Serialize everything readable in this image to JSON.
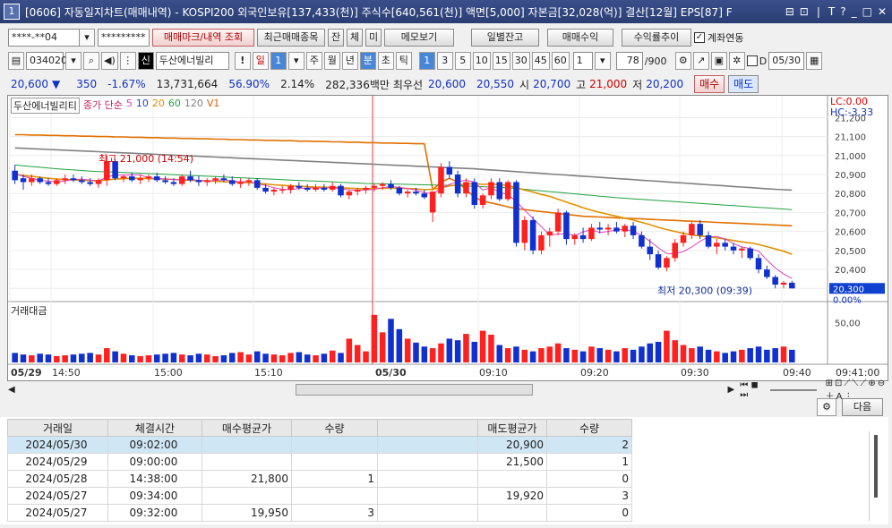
{
  "window": {
    "num": "1",
    "title": "[0606] 자동일지차트(매매내역) - KOSPI200 외국인보유[137,433(천)] 주식수[640,561(천)] 액면[5,000] 자본금[32,028(억)] 결산[12월] EPS[87] F",
    "controls": [
      "⊟",
      "⊡",
      "❘",
      "T",
      "?",
      "_",
      "□",
      "✕"
    ]
  },
  "toolbar1": {
    "account": "****-**04",
    "password": "*********",
    "btn_marks": "매매마크/내역 조회",
    "btn_recent": "최근매매종목",
    "btn_jan": "잔",
    "btn_che": "체",
    "btn_mi": "미",
    "btn_memo": "메모보기",
    "btn_daily": "일별잔고",
    "btn_profit": "매매수익",
    "btn_rate": "수익률추이",
    "chk_link": "계좌연동"
  },
  "toolbar2": {
    "code": "034020",
    "name_badge": "신",
    "name": "두산에너빌리",
    "period": [
      "일",
      "1",
      "주",
      "월",
      "년",
      "분",
      "초",
      "틱"
    ],
    "nums": [
      "1",
      "3",
      "5",
      "10",
      "15",
      "30",
      "45",
      "60"
    ],
    "count": "1",
    "view": "78",
    "total": "/900",
    "date_label": "D",
    "date": "05/30"
  },
  "quote": {
    "price": "20,600",
    "arrow": "▼",
    "change": "350",
    "pct": "-1.67%",
    "volume": "13,731,664",
    "vol_ratio": "56.90%",
    "turnover": "2.14%",
    "amount": "282,336백만",
    "best_label": "최우선",
    "ask": "20,600",
    "bid": "20,550",
    "open_label": "시",
    "open": "20,700",
    "high_label": "고",
    "high": "21,000",
    "low_label": "저",
    "low": "20,200",
    "buy": "매수",
    "sell": "매도"
  },
  "chart_data": {
    "type": "candlestick",
    "stock": "두산에너빌리티",
    "legend_price": "종가 단순",
    "ma_periods": [
      "5",
      "10",
      "20",
      "60",
      "120"
    ],
    "v1": "V1",
    "lc": "LC:0.00",
    "hc": "HC:-3.33",
    "max_label": "최고 21,000 (14:54)",
    "min_label": "최저 20,300 (09:39)",
    "last_label": "20,300",
    "last_pct": "0.00%",
    "yticks": [
      "21,200",
      "21,100",
      "21,000",
      "20,900",
      "20,800",
      "20,700",
      "20,600",
      "20,500",
      "20,400",
      "20,300"
    ],
    "ylim": [
      20240,
      21230
    ],
    "vol_title": "거래대금",
    "vol_tick": "50,00",
    "xticks": [
      {
        "label": "05/29",
        "bold": true
      },
      {
        "label": "14:50"
      },
      {
        "label": "15:00"
      },
      {
        "label": "15:10"
      },
      {
        "label": "05/30",
        "bold": true
      },
      {
        "label": "09:10"
      },
      {
        "label": "09:20"
      },
      {
        "label": "09:30"
      },
      {
        "label": "09:40"
      },
      {
        "label": "09:41:00"
      }
    ],
    "candles": [
      [
        20920,
        20950,
        20850,
        20870
      ],
      [
        20880,
        20900,
        20820,
        20860
      ],
      [
        20860,
        20900,
        20840,
        20880
      ],
      [
        20880,
        20890,
        20850,
        20860
      ],
      [
        20860,
        20880,
        20840,
        20850
      ],
      [
        20850,
        20880,
        20840,
        20870
      ],
      [
        20870,
        20900,
        20850,
        20880
      ],
      [
        20880,
        20900,
        20860,
        20870
      ],
      [
        20870,
        20890,
        20850,
        20860
      ],
      [
        20860,
        20880,
        20840,
        20850
      ],
      [
        20850,
        20880,
        20830,
        20870
      ],
      [
        20870,
        21000,
        20840,
        20970
      ],
      [
        20970,
        20980,
        20870,
        20880
      ],
      [
        20880,
        20900,
        20860,
        20890
      ],
      [
        20890,
        20910,
        20860,
        20870
      ],
      [
        20870,
        20900,
        20850,
        20880
      ],
      [
        20880,
        20900,
        20860,
        20890
      ],
      [
        20890,
        20910,
        20860,
        20870
      ],
      [
        20870,
        20890,
        20850,
        20860
      ],
      [
        20860,
        20880,
        20840,
        20850
      ],
      [
        20850,
        20900,
        20840,
        20890
      ],
      [
        20890,
        20920,
        20860,
        20870
      ],
      [
        20870,
        20890,
        20840,
        20860
      ],
      [
        20860,
        20880,
        20840,
        20870
      ],
      [
        20870,
        20890,
        20850,
        20880
      ],
      [
        20880,
        20900,
        20860,
        20870
      ],
      [
        20870,
        20890,
        20840,
        20850
      ],
      [
        20850,
        20880,
        20830,
        20860
      ],
      [
        20860,
        20880,
        20840,
        20870
      ],
      [
        20870,
        20880,
        20820,
        20830
      ],
      [
        20830,
        20850,
        20800,
        20810
      ],
      [
        20810,
        20830,
        20790,
        20820
      ],
      [
        20820,
        20840,
        20800,
        20820
      ],
      [
        20820,
        20850,
        20800,
        20840
      ],
      [
        20840,
        20860,
        20820,
        20830
      ],
      [
        20830,
        20850,
        20810,
        20820
      ],
      [
        20820,
        20850,
        20810,
        20830
      ],
      [
        20830,
        20850,
        20810,
        20820
      ],
      [
        20820,
        20860,
        20810,
        20840
      ],
      [
        20840,
        20850,
        20780,
        20790
      ],
      [
        20790,
        20820,
        20770,
        20810
      ],
      [
        20810,
        20830,
        20790,
        20820
      ],
      [
        20820,
        20840,
        20800,
        20830
      ],
      [
        20830,
        20850,
        20810,
        20840
      ],
      [
        20840,
        20860,
        20820,
        20850
      ],
      [
        20850,
        20870,
        20820,
        20830
      ],
      [
        20830,
        20840,
        20790,
        20800
      ],
      [
        20800,
        20820,
        20780,
        20810
      ],
      [
        20810,
        20830,
        20790,
        20800
      ],
      [
        20800,
        20820,
        20770,
        20780
      ],
      [
        20700,
        20810,
        20650,
        20810
      ],
      [
        20800,
        20960,
        20780,
        20940
      ],
      [
        20940,
        20970,
        20880,
        20900
      ],
      [
        20900,
        20920,
        20780,
        20800
      ],
      [
        20800,
        20880,
        20780,
        20860
      ],
      [
        20860,
        20880,
        20720,
        20740
      ],
      [
        20740,
        20800,
        20720,
        20790
      ],
      [
        20790,
        20880,
        20770,
        20860
      ],
      [
        20860,
        20880,
        20760,
        20770
      ],
      [
        20770,
        20870,
        20760,
        20860
      ],
      [
        20860,
        20870,
        20520,
        20540
      ],
      [
        20540,
        20680,
        20500,
        20660
      ],
      [
        20660,
        20680,
        20480,
        20500
      ],
      [
        20500,
        20600,
        20480,
        20580
      ],
      [
        20580,
        20620,
        20520,
        20600
      ],
      [
        20600,
        20720,
        20580,
        20700
      ],
      [
        20700,
        20710,
        20530,
        20560
      ],
      [
        20560,
        20590,
        20530,
        20580
      ],
      [
        20580,
        20620,
        20540,
        20560
      ],
      [
        20560,
        20640,
        20550,
        20620
      ],
      [
        20620,
        20650,
        20590,
        20610
      ],
      [
        20610,
        20640,
        20580,
        20620
      ],
      [
        20620,
        20650,
        20590,
        20600
      ],
      [
        20600,
        20640,
        20570,
        20630
      ],
      [
        20630,
        20650,
        20560,
        20580
      ],
      [
        20580,
        20600,
        20510,
        20520
      ],
      [
        20520,
        20560,
        20450,
        20480
      ],
      [
        20480,
        20500,
        20400,
        20410
      ],
      [
        20410,
        20470,
        20390,
        20460
      ],
      [
        20460,
        20560,
        20440,
        20540
      ],
      [
        20540,
        20600,
        20520,
        20580
      ],
      [
        20580,
        20650,
        20560,
        20640
      ],
      [
        20640,
        20660,
        20560,
        20580
      ],
      [
        20580,
        20600,
        20510,
        20520
      ],
      [
        20520,
        20560,
        20480,
        20540
      ],
      [
        20540,
        20560,
        20500,
        20520
      ],
      [
        20520,
        20540,
        20480,
        20500
      ],
      [
        20500,
        20520,
        20460,
        20510
      ],
      [
        20510,
        20520,
        20450,
        20460
      ],
      [
        20460,
        20480,
        20380,
        20400
      ],
      [
        20400,
        20420,
        20350,
        20360
      ],
      [
        20360,
        20370,
        20300,
        20320
      ],
      [
        20320,
        20340,
        20300,
        20330
      ],
      [
        20330,
        20340,
        20300,
        20300
      ]
    ],
    "volumes": [
      12,
      10,
      9,
      11,
      10,
      8,
      9,
      10,
      11,
      12,
      10,
      18,
      14,
      11,
      9,
      8,
      9,
      10,
      11,
      12,
      10,
      9,
      11,
      10,
      8,
      9,
      12,
      13,
      10,
      14,
      11,
      10,
      9,
      12,
      13,
      10,
      9,
      11,
      15,
      12,
      30,
      22,
      14,
      60,
      38,
      55,
      42,
      30,
      25,
      20,
      18,
      24,
      30,
      28,
      36,
      26,
      40,
      35,
      22,
      18,
      20,
      16,
      14,
      18,
      20,
      24,
      18,
      16,
      14,
      20,
      18,
      16,
      14,
      18,
      16,
      20,
      24,
      26,
      40,
      28,
      22,
      18,
      20,
      16,
      14,
      12,
      14,
      16,
      18,
      20,
      16,
      18,
      20,
      16
    ],
    "ma5": [
      20905,
      20890,
      20880,
      20870,
      20865,
      20862,
      20866,
      20873,
      20876,
      20871,
      20866,
      20886,
      20898,
      20896,
      20898,
      20898,
      20882,
      20879,
      20876,
      20874,
      20870,
      20875,
      20869,
      20866,
      20868,
      20872,
      20866,
      20862,
      20863,
      20852,
      20842,
      20830,
      20822,
      20820,
      20827,
      20828,
      20830,
      20828,
      20831,
      20825,
      20819,
      20817,
      20819,
      20822,
      20830,
      20837,
      20832,
      20826,
      20818,
      20804,
      20800,
      20826,
      20848,
      20862,
      20870,
      20860,
      20818,
      20830,
      20806,
      20794,
      20758,
      20712,
      20668,
      20626,
      20580,
      20586,
      20588,
      20578,
      20598,
      20610,
      20594,
      20600,
      20608,
      20612,
      20600,
      20580,
      20548,
      20514,
      20484,
      20482,
      20494,
      20518,
      20548,
      20572,
      20574,
      20560,
      20536,
      20518,
      20510,
      20496,
      20450,
      20408,
      20376,
      20352
    ],
    "ma20": [
      20900,
      20895,
      20890,
      20885,
      20880,
      20876,
      20874,
      20872,
      20870,
      20868,
      20868,
      20872,
      20876,
      20878,
      20880,
      20880,
      20878,
      20877,
      20876,
      20874,
      20872,
      20870,
      20868,
      20866,
      20864,
      20862,
      20860,
      20858,
      20857,
      20854,
      20850,
      20846,
      20843,
      20840,
      20838,
      20836,
      20834,
      20833,
      20832,
      20830,
      20828,
      20826,
      20825,
      20826,
      20827,
      20828,
      20828,
      20826,
      20824,
      20820,
      20822,
      20830,
      20840,
      20846,
      20850,
      20852,
      20848,
      20850,
      20846,
      20842,
      20830,
      20818,
      20808,
      20795,
      20785,
      20770,
      20755,
      20740,
      20725,
      20712,
      20700,
      20690,
      20680,
      20670,
      20660,
      20648,
      20636,
      20622,
      20610,
      20600,
      20590,
      20582,
      20576,
      20572,
      20566,
      20560,
      20552,
      20545,
      20540,
      20532,
      20520,
      20508,
      20496,
      20480
    ],
    "ma60": [
      20950,
      20946,
      20942,
      20938,
      20934,
      20930,
      20927,
      20924,
      20921,
      20918,
      20915,
      20914,
      20913,
      20911,
      20909,
      20907,
      20905,
      20903,
      20901,
      20899,
      20897,
      20895,
      20893,
      20891,
      20889,
      20887,
      20885,
      20883,
      20881,
      20879,
      20877,
      20875,
      20873,
      20871,
      20869,
      20867,
      20865,
      20863,
      20861,
      20859,
      20857,
      20855,
      20853,
      20852,
      20851,
      20850,
      20849,
      20848,
      20847,
      20846,
      20845,
      20844,
      20843,
      20842,
      20840,
      20838,
      20836,
      20834,
      20832,
      20830,
      20826,
      20822,
      20818,
      20814,
      20810,
      20806,
      20802,
      20798,
      20794,
      20790,
      20786,
      20782,
      20778,
      20775,
      20772,
      20769,
      20766,
      20763,
      20760,
      20757,
      20754,
      20751,
      20748,
      20745,
      20742,
      20739,
      20736,
      20733,
      20730,
      20727,
      20724,
      20721,
      20718,
      20715
    ],
    "ma120": [
      21040,
      21038,
      21036,
      21034,
      21032,
      21030,
      21028,
      21026,
      21024,
      21022,
      21020,
      21018,
      21016,
      21014,
      21012,
      21010,
      21008,
      21006,
      21004,
      21002,
      21000,
      20998,
      20996,
      20994,
      20992,
      20990,
      20988,
      20986,
      20984,
      20982,
      20980,
      20978,
      20976,
      20974,
      20972,
      20970,
      20968,
      20966,
      20964,
      20962,
      20960,
      20958,
      20956,
      20954,
      20952,
      20950,
      20948,
      20946,
      20944,
      20942,
      20940,
      20938,
      20936,
      20934,
      20932,
      20930,
      20927,
      20924,
      20921,
      20918,
      20915,
      20912,
      20909,
      20906,
      20903,
      20900,
      20897,
      20894,
      20891,
      20888,
      20885,
      20882,
      20879,
      20876,
      20873,
      20870,
      20867,
      20864,
      20861,
      20858,
      20855,
      20852,
      20849,
      20846,
      20843,
      20840,
      20837,
      20834,
      20831,
      20828,
      20825,
      20822,
      20820,
      20818
    ],
    "v1_line": [
      21110,
      21110,
      21108,
      21108,
      21106,
      21106,
      21104,
      21104,
      21102,
      21102,
      21100,
      21100,
      21098,
      21098,
      21096,
      21096,
      21094,
      21094,
      21092,
      21092,
      21090,
      21090,
      21088,
      21088,
      21086,
      21086,
      21084,
      21084,
      21082,
      21082,
      21080,
      21080,
      21078,
      21078,
      21076,
      21076,
      21074,
      21074,
      21072,
      21072,
      21070,
      21070,
      21068,
      21068,
      21066,
      21066,
      21064,
      21064,
      21062,
      21062,
      20820,
      20860,
      20880,
      20860,
      20820,
      20780,
      20760,
      20750,
      20740,
      20730,
      20720,
      20715,
      20710,
      20705,
      20700,
      20695,
      20690,
      20685,
      20680,
      20678,
      20676,
      20674,
      20672,
      20670,
      20668,
      20666,
      20664,
      20662,
      20660,
      20658,
      20656,
      20654,
      20652,
      20650,
      20648,
      20646,
      20644,
      20642,
      20640,
      20638,
      20636,
      20634,
      20632,
      20630
    ]
  },
  "hscroll": {
    "arrow_left": "◀",
    "arrow_right": "▶"
  },
  "bottom": {
    "next_btn": "다음",
    "columns": [
      "거래일",
      "체결시간",
      "매수평균가",
      "수량",
      "",
      "매도평균가",
      "수량"
    ],
    "rows": [
      [
        "2024/05/30",
        "09:02:00",
        "",
        "",
        "",
        "20,900",
        "2"
      ],
      [
        "2024/05/29",
        "09:00:00",
        "",
        "",
        "",
        "21,500",
        "1"
      ],
      [
        "2024/05/28",
        "14:38:00",
        "21,800",
        "1",
        "",
        "",
        "0"
      ],
      [
        "2024/05/27",
        "09:34:00",
        "",
        "",
        "",
        "19,920",
        "3"
      ],
      [
        "2024/05/27",
        "09:32:00",
        "19,950",
        "3",
        "",
        "",
        "0"
      ]
    ]
  }
}
